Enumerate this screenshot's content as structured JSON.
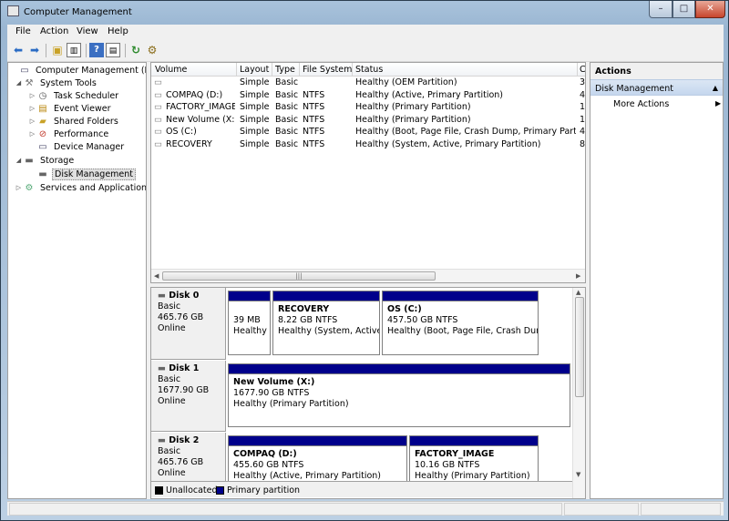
{
  "window": {
    "title": "Computer Management",
    "min": "–",
    "max": "□",
    "close": "✕"
  },
  "menu": [
    "File",
    "Action",
    "View",
    "Help"
  ],
  "tree": [
    {
      "label": "Computer Management (Local",
      "icon": "computer-icon",
      "level": 0,
      "twisty": ""
    },
    {
      "label": "System Tools",
      "icon": "tools-icon",
      "level": 1,
      "twisty": "◢"
    },
    {
      "label": "Task Scheduler",
      "icon": "clock-icon",
      "level": 2,
      "twisty": "▷"
    },
    {
      "label": "Event Viewer",
      "icon": "event-viewer-icon",
      "level": 2,
      "twisty": "▷"
    },
    {
      "label": "Shared Folders",
      "icon": "folder-icon",
      "level": 2,
      "twisty": "▷"
    },
    {
      "label": "Performance",
      "icon": "performance-icon",
      "level": 2,
      "twisty": "▷"
    },
    {
      "label": "Device Manager",
      "icon": "device-manager-icon",
      "level": 2,
      "twisty": ""
    },
    {
      "label": "Storage",
      "icon": "storage-icon",
      "level": 1,
      "twisty": "◢"
    },
    {
      "label": "Disk Management",
      "icon": "disk-icon",
      "level": 2,
      "twisty": "",
      "selected": true
    },
    {
      "label": "Services and Applications",
      "icon": "services-icon",
      "level": 1,
      "twisty": "▷"
    }
  ],
  "volumes": {
    "columns": [
      "Volume",
      "Layout",
      "Type",
      "File System",
      "Status",
      "C"
    ],
    "rows": [
      {
        "volume": "",
        "layout": "Simple",
        "type": "Basic",
        "fs": "",
        "status": "Healthy (OEM Partition)",
        "cap": "3"
      },
      {
        "volume": "COMPAQ (D:)",
        "layout": "Simple",
        "type": "Basic",
        "fs": "NTFS",
        "status": "Healthy (Active, Primary Partition)",
        "cap": "4"
      },
      {
        "volume": "FACTORY_IMAGE",
        "layout": "Simple",
        "type": "Basic",
        "fs": "NTFS",
        "status": "Healthy (Primary Partition)",
        "cap": "1"
      },
      {
        "volume": "New Volume (X:)",
        "layout": "Simple",
        "type": "Basic",
        "fs": "NTFS",
        "status": "Healthy (Primary Partition)",
        "cap": "1"
      },
      {
        "volume": "OS (C:)",
        "layout": "Simple",
        "type": "Basic",
        "fs": "NTFS",
        "status": "Healthy (Boot, Page File, Crash Dump, Primary Partition)",
        "cap": "4"
      },
      {
        "volume": "RECOVERY",
        "layout": "Simple",
        "type": "Basic",
        "fs": "NTFS",
        "status": "Healthy (System, Active, Primary Partition)",
        "cap": "8"
      }
    ]
  },
  "disks": [
    {
      "name": "Disk 0",
      "type": "Basic",
      "size": "465.76 GB",
      "state": "Online",
      "partitions": [
        {
          "name": "",
          "size": "39 MB",
          "status": "Healthy"
        },
        {
          "name": "RECOVERY",
          "size": "8.22 GB NTFS",
          "status": "Healthy (System, Active, F"
        },
        {
          "name": "OS  (C:)",
          "size": "457.50 GB NTFS",
          "status": "Healthy (Boot, Page File, Crash Dump,"
        }
      ]
    },
    {
      "name": "Disk 1",
      "type": "Basic",
      "size": "1677.90 GB",
      "state": "Online",
      "partitions": [
        {
          "name": "New Volume  (X:)",
          "size": "1677.90 GB NTFS",
          "status": "Healthy (Primary Partition)"
        }
      ]
    },
    {
      "name": "Disk 2",
      "type": "Basic",
      "size": "465.76 GB",
      "state": "Online",
      "partitions": [
        {
          "name": "COMPAQ  (D:)",
          "size": "455.60 GB NTFS",
          "status": "Healthy (Active, Primary Partition)"
        },
        {
          "name": "FACTORY_IMAGE",
          "size": "10.16 GB NTFS",
          "status": "Healthy (Primary Partition)"
        }
      ]
    }
  ],
  "legend": [
    {
      "label": "Unallocated",
      "color": "#000000"
    },
    {
      "label": "Primary partition",
      "color": "#00008b"
    }
  ],
  "actions": {
    "header": "Actions",
    "section": "Disk Management",
    "item": "More Actions"
  }
}
